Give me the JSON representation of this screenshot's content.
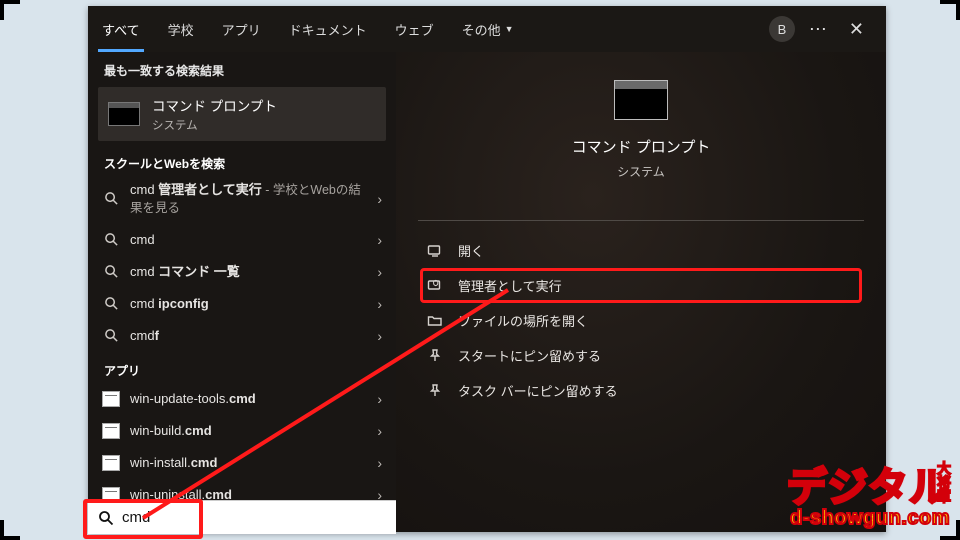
{
  "tabs": {
    "all": "すべて",
    "school": "学校",
    "apps": "アプリ",
    "documents": "ドキュメント",
    "web": "ウェブ",
    "more": "その他"
  },
  "avatar_initial": "B",
  "left": {
    "best_section": "最も一致する検索結果",
    "best": {
      "title": "コマンド プロンプト",
      "subtitle": "システム"
    },
    "search_section": "スクールとWebを検索",
    "items": [
      {
        "prefix": "cmd",
        "bold": " 管理者として実行",
        "suffix": " - 学校とWebの結果を見る"
      },
      {
        "prefix": "cmd",
        "bold": "",
        "suffix": ""
      },
      {
        "prefix": "cmd",
        "bold": " コマンド 一覧",
        "suffix": ""
      },
      {
        "prefix": "cmd",
        "bold": " ipconfig",
        "suffix": ""
      },
      {
        "prefix": "cmd",
        "bold": "f",
        "suffix": ""
      }
    ],
    "apps_section": "アプリ",
    "app_items": [
      {
        "pre": "win-update-tools.",
        "ext": "cmd"
      },
      {
        "pre": "win-build.",
        "ext": "cmd"
      },
      {
        "pre": "win-install.",
        "ext": "cmd"
      },
      {
        "pre": "win-uninstall.",
        "ext": "cmd"
      }
    ]
  },
  "right": {
    "title": "コマンド プロンプト",
    "subtitle": "システム",
    "actions": {
      "open": "開く",
      "run_admin": "管理者として実行",
      "open_location": "ファイルの場所を開く",
      "pin_start": "スタートにピン留めする",
      "pin_taskbar": "タスク バーにピン留めする"
    }
  },
  "search_value": "cmd",
  "watermark": {
    "big": "デジタル",
    "side": "大将軍",
    "url": "d-showgun.com"
  }
}
